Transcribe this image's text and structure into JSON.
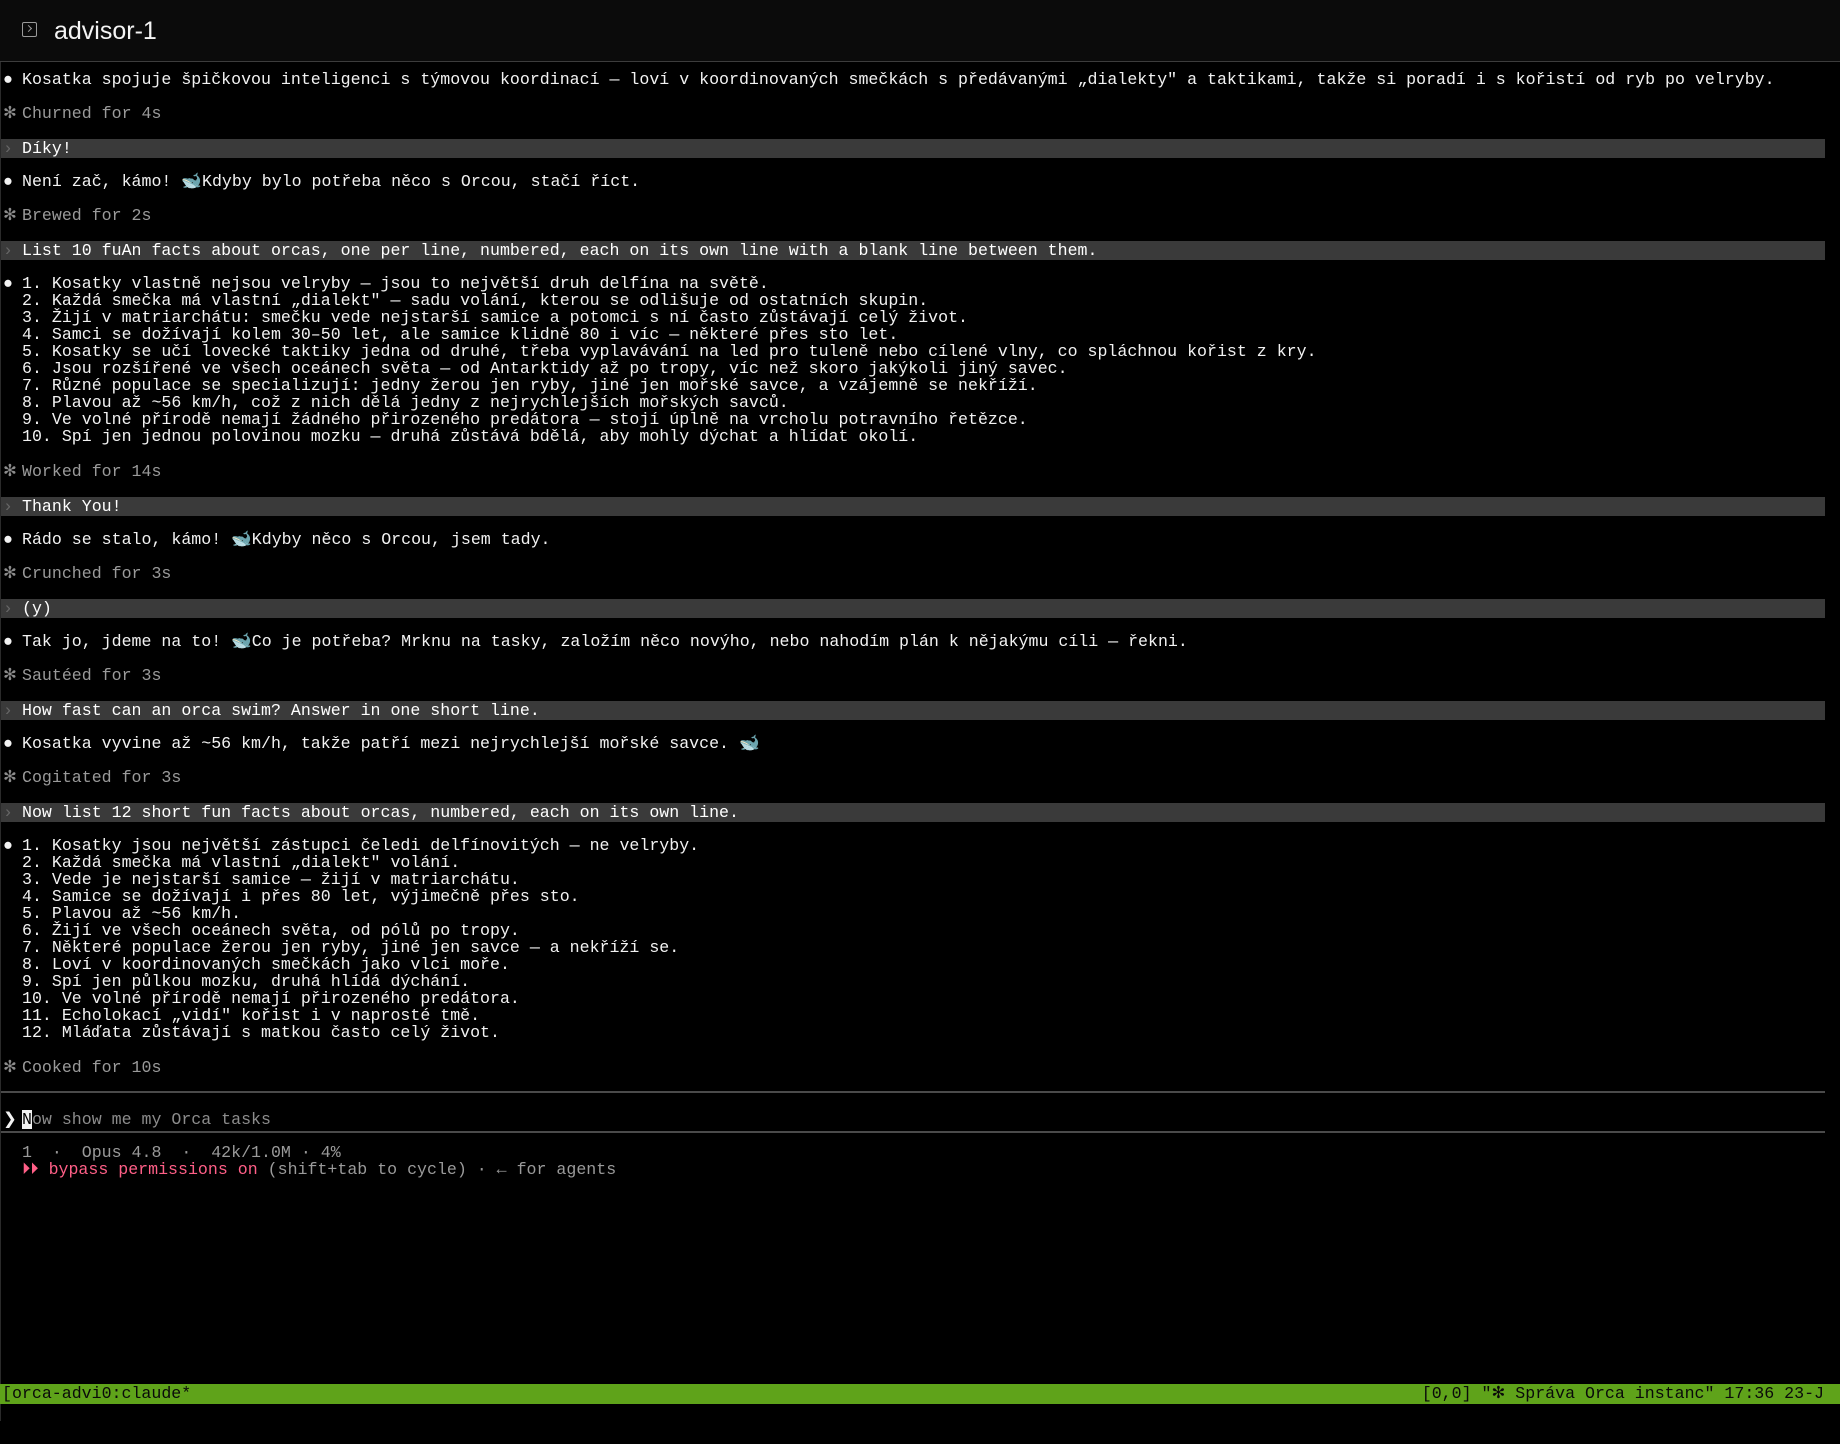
{
  "window": {
    "title": "advisor-1",
    "icon": "terminal-icon"
  },
  "colors": {
    "background": "#000000",
    "user_message_bg": "#3a3a3a",
    "tmux_bar": "#5fa31a",
    "bypass_red": "#ff5f87"
  },
  "symbols": {
    "bullet": "●",
    "status": "✻",
    "user": "›",
    "prompt": "❯"
  },
  "transcript": {
    "m1": "Kosatka spojuje špičkovou inteligenci s týmovou koordinací — loví v koordinovaných smečkách s předávanými „dialekty\" a taktikami, takže si poradí i s kořistí od ryb po velryby.",
    "s1": "Churned for 4s",
    "u1": "Díky!",
    "m2": "Není zač, kámo! 🐋Kdyby bylo potřeba něco s Orcou, stačí říct.",
    "s2": "Brewed for 2s",
    "u2": "List 10 fuAn facts about orcas, one per line, numbered, each on its own line with a blank line between them.",
    "list1": [
      "1. Kosatky vlastně nejsou velryby — jsou to největší druh delfína na světě.",
      "2. Každá smečka má vlastní „dialekt\" — sadu volání, kterou se odlišuje od ostatních skupin.",
      "3. Žijí v matriarchátu: smečku vede nejstarší samice a potomci s ní často zůstávají celý život.",
      "4. Samci se dožívají kolem 30–50 let, ale samice klidně 80 i víc — některé přes sto let.",
      "5. Kosatky se učí lovecké taktiky jedna od druhé, třeba vyplavávání na led pro tuleně nebo cílené vlny, co spláchnou kořist z kry.",
      "6. Jsou rozšířené ve všech oceánech světa — od Antarktidy až po tropy, víc než skoro jakýkoli jiný savec.",
      "7. Různé populace se specializují: jedny žerou jen ryby, jiné jen mořské savce, a vzájemně se nekříží.",
      "8. Plavou až ~56 km/h, což z nich dělá jedny z nejrychlejších mořských savců.",
      "9. Ve volné přírodě nemají žádného přirozeného predátora — stojí úplně na vrcholu potravního řetězce.",
      "10. Spí jen jednou polovinou mozku — druhá zůstává bdělá, aby mohly dýchat a hlídat okolí."
    ],
    "s3": "Worked for 14s",
    "u3": "Thank You!",
    "m3": "Rádo se stalo, kámo! 🐋Kdyby něco s Orcou, jsem tady.",
    "s4": "Crunched for 3s",
    "u4": "(y)",
    "m4": "Tak jo, jdeme na to! 🐋Co je potřeba? Mrknu na tasky, založím něco novýho, nebo nahodím plán k nějakýmu cíli — řekni.",
    "s5": "Sautéed for 3s",
    "u5": "How fast can an orca swim? Answer in one short line.",
    "m5": "Kosatka vyvine až ~56 km/h, takže patří mezi nejrychlejší mořské savce. 🐋",
    "s6": "Cogitated for 3s",
    "u6": "Now list 12 short fun facts about orcas, numbered, each on its own line.",
    "list2": [
      "1. Kosatky jsou největší zástupci čeledi delfínovitých — ne velryby.",
      "2. Každá smečka má vlastní „dialekt\" volání.",
      "3. Vede je nejstarší samice — žijí v matriarchátu.",
      "4. Samice se dožívají i přes 80 let, výjimečně přes sto.",
      "5. Plavou až ~56 km/h.",
      "6. Žijí ve všech oceánech světa, od pólů po tropy.",
      "7. Některé populace žerou jen ryby, jiné jen savce — a nekříží se.",
      "8. Loví v koordinovaných smečkách jako vlci moře.",
      "9. Spí jen půlkou mozku, druhá hlídá dýchání.",
      "10. Ve volné přírodě nemají přirozeného predátora.",
      "11. Echolokací „vidí\" kořist i v naprosté tmě.",
      "12. Mláďata zůstávají s matkou často celý život."
    ],
    "s7": "Cooked for 10s"
  },
  "prompt": {
    "cursor_char": "N",
    "placeholder_rest": "ow show me my Orca tasks"
  },
  "footer": {
    "session_line": "1  ·  Opus 4.8  ·  42k/1.0M · 4%",
    "bypass_icon": "⏵⏵",
    "bypass_label": "bypass permissions on",
    "bypass_hint": "(shift+tab to cycle) · ← for agents"
  },
  "tmux": {
    "left": "[orca-advi0:claude*",
    "right": "[0,0] \"✻ Správa Orca instanc\" 17:36 23-J"
  }
}
